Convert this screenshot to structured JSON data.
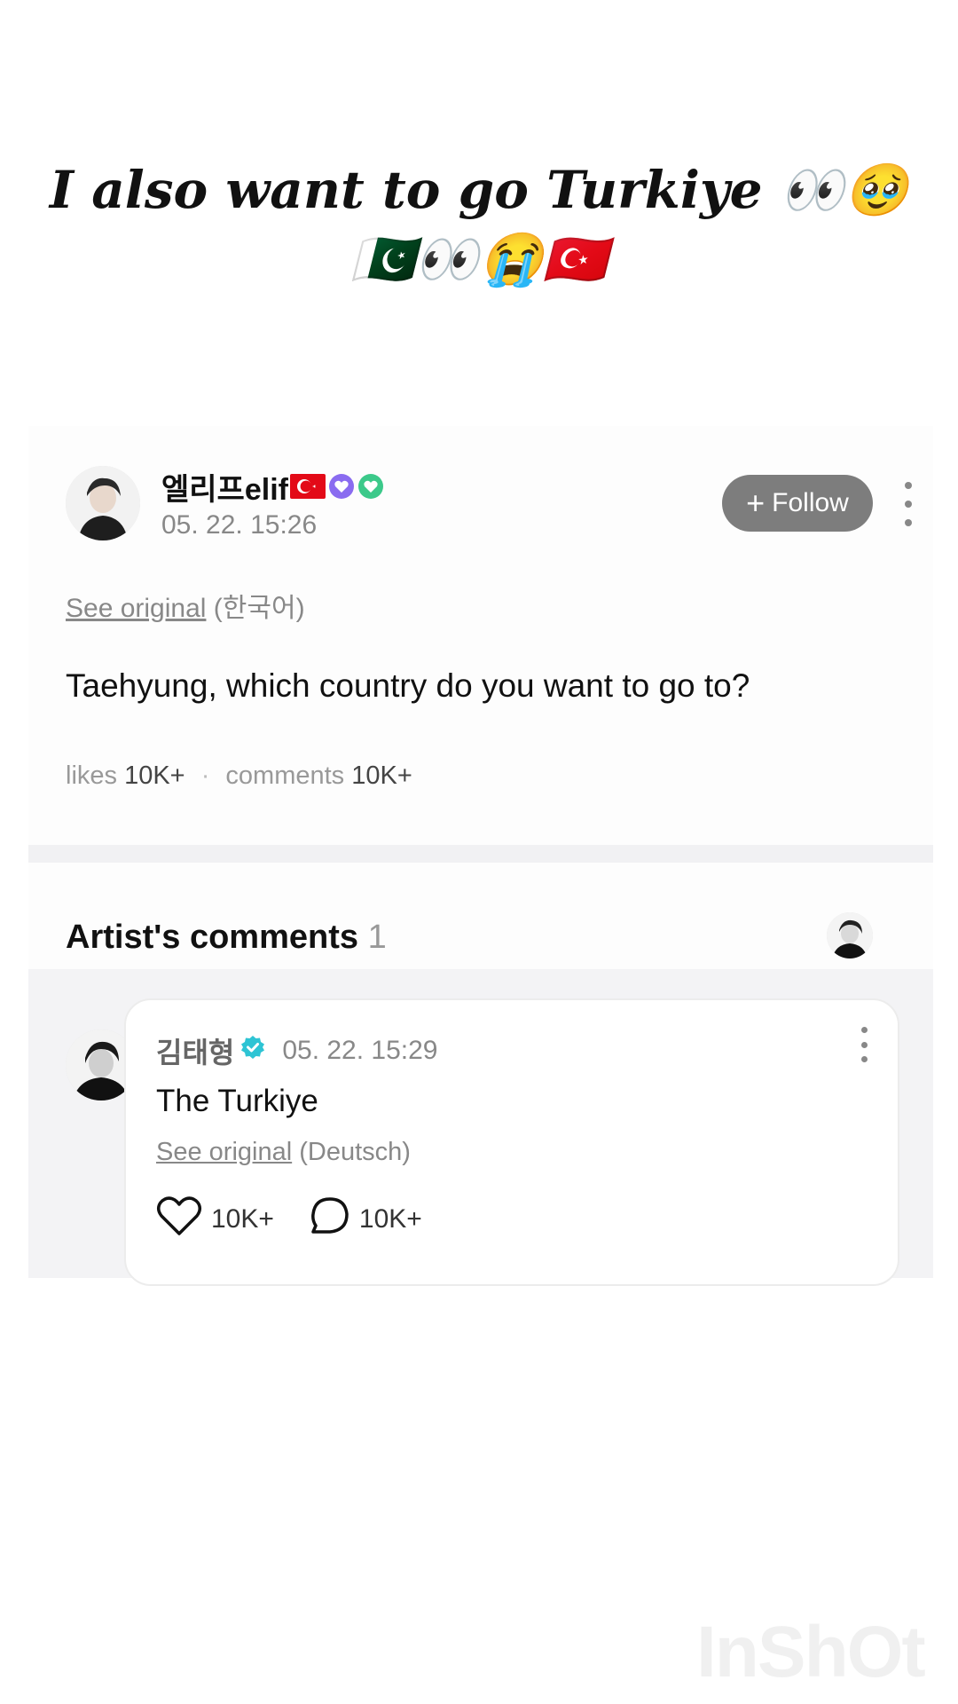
{
  "caption": {
    "line1": "I also want to go Turkiye 👀🥹",
    "line2": "🇵🇰👀😭🇹🇷"
  },
  "post": {
    "author_name": "엘리프elif",
    "timestamp": "05. 22. 15:26",
    "follow_label": "Follow",
    "see_original_link": "See original",
    "see_original_lang": "(한국어)",
    "body": "Taehyung, which country do you want to go to?",
    "likes_label": "likes",
    "likes_value": "10K+",
    "comments_label": "comments",
    "comments_value": "10K+"
  },
  "artist_comments": {
    "title": "Artist's comments",
    "count": "1",
    "comment": {
      "author": "김태형",
      "timestamp": "05. 22. 15:29",
      "text": "The Turkiye",
      "see_original_link": "See original",
      "see_original_lang": "(Deutsch)",
      "likes": "10K+",
      "replies": "10K+"
    }
  },
  "watermark": "InShOt",
  "colors": {
    "follow_button": "#7d7d7d",
    "verified_badge": "#2ec4d4",
    "turkey_flag": "#e30a17"
  }
}
